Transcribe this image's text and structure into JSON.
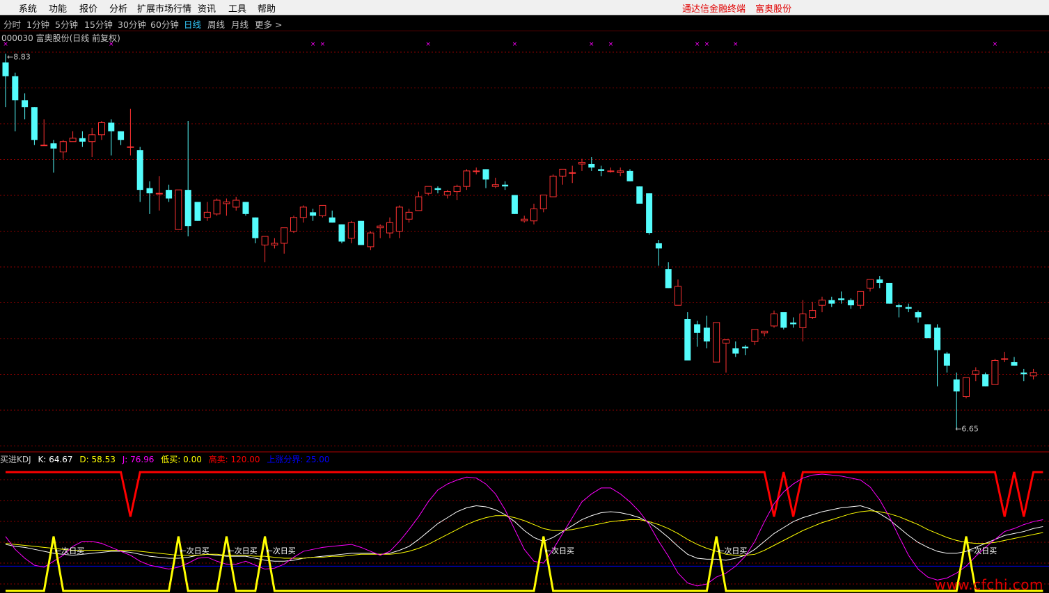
{
  "menu": {
    "items": [
      "系统",
      "功能",
      "报价",
      "分析",
      "扩展市场行情",
      "资讯",
      "工具",
      "帮助"
    ],
    "right_items": [
      "通达信金融终端",
      "富奥股份"
    ]
  },
  "periods": {
    "items": [
      "分时",
      "1分钟",
      "5分钟",
      "15分钟",
      "30分钟",
      "60分钟",
      "日线",
      "周线",
      "月线",
      "更多 >"
    ],
    "active_index": 6
  },
  "main": {
    "title": "000030 富奥股份(日线 前复权)",
    "high_label": "8.83",
    "low_label": "6.65"
  },
  "kdj": {
    "name": "买进KDJ",
    "k_label": "K: 64.67",
    "d_label": "D: 58.53",
    "j_label": "J: 76.96",
    "low_label": "低买: 0.00",
    "high_label": "高卖: 120.00",
    "line_label": "上涨分界: 25.00",
    "buy_text": "次日买"
  },
  "watermark": "www.cfchi.com",
  "colors": {
    "up": "#ff3232",
    "down": "#54fcfc",
    "k": "#ffffff",
    "d": "#ffff00",
    "j": "#ff00ff",
    "signal": "#ffff00",
    "sell": "#ff0000",
    "divider": "#0000ff"
  },
  "chart_data": [
    {
      "type": "candlestick",
      "title": "000030 富奥股份(日线 前复权)",
      "price_range": [
        6.6,
        8.9
      ],
      "annotations": [
        "8.83",
        "6.65"
      ],
      "candles": [
        [
          8.78,
          8.83,
          8.52,
          8.7
        ],
        [
          8.7,
          8.72,
          8.38,
          8.56
        ],
        [
          8.56,
          8.6,
          8.45,
          8.52
        ],
        [
          8.52,
          8.52,
          8.3,
          8.33
        ],
        [
          8.3,
          8.45,
          8.3,
          8.3
        ],
        [
          8.31,
          8.33,
          8.14,
          8.28
        ],
        [
          8.26,
          8.33,
          8.22,
          8.32
        ],
        [
          8.32,
          8.38,
          8.33,
          8.34
        ],
        [
          8.34,
          8.38,
          8.29,
          8.32
        ],
        [
          8.32,
          8.4,
          8.23,
          8.36
        ],
        [
          8.36,
          8.44,
          8.33,
          8.43
        ],
        [
          8.43,
          8.45,
          8.24,
          8.38
        ],
        [
          8.38,
          8.38,
          8.3,
          8.33
        ],
        [
          8.29,
          8.51,
          8.24,
          8.29
        ],
        [
          8.27,
          8.29,
          7.97,
          8.04
        ],
        [
          8.05,
          8.09,
          7.9,
          8.02
        ],
        [
          8.02,
          8.12,
          7.92,
          8.02
        ],
        [
          8.04,
          8.07,
          7.97,
          7.99
        ],
        [
          7.81,
          8.02,
          7.81,
          8.04
        ],
        [
          8.04,
          8.44,
          7.77,
          7.83
        ],
        [
          7.97,
          7.97,
          7.86,
          7.86
        ],
        [
          7.88,
          7.97,
          7.86,
          7.91
        ],
        [
          7.9,
          7.99,
          7.89,
          7.98
        ],
        [
          7.96,
          7.99,
          7.89,
          7.97
        ],
        [
          7.94,
          8.0,
          7.92,
          7.98
        ],
        [
          7.97,
          7.97,
          7.89,
          7.9
        ],
        [
          7.88,
          7.88,
          7.73,
          7.76
        ],
        [
          7.72,
          7.76,
          7.62,
          7.77
        ],
        [
          7.72,
          7.76,
          7.7,
          7.73
        ],
        [
          7.73,
          7.82,
          7.67,
          7.82
        ],
        [
          7.8,
          7.89,
          7.79,
          7.88
        ],
        [
          7.88,
          7.95,
          7.85,
          7.94
        ],
        [
          7.91,
          7.93,
          7.86,
          7.89
        ],
        [
          7.89,
          7.95,
          7.88,
          7.95
        ],
        [
          7.88,
          7.92,
          7.85,
          7.85
        ],
        [
          7.84,
          7.84,
          7.73,
          7.74
        ],
        [
          7.76,
          7.86,
          7.73,
          7.85
        ],
        [
          7.86,
          7.86,
          7.72,
          7.72
        ],
        [
          7.71,
          7.8,
          7.69,
          7.79
        ],
        [
          7.82,
          7.84,
          7.76,
          7.83
        ],
        [
          7.79,
          7.88,
          7.76,
          7.85
        ],
        [
          7.8,
          7.95,
          7.76,
          7.94
        ],
        [
          7.87,
          7.93,
          7.85,
          7.91
        ],
        [
          7.92,
          8.03,
          7.92,
          8.0
        ],
        [
          8.02,
          8.06,
          8.01,
          8.06
        ],
        [
          8.05,
          8.06,
          8.02,
          8.04
        ],
        [
          8.01,
          8.04,
          7.99,
          8.03
        ],
        [
          8.03,
          8.07,
          7.98,
          8.06
        ],
        [
          8.06,
          8.16,
          8.04,
          8.15
        ],
        [
          8.15,
          8.17,
          8.13,
          8.15
        ],
        [
          8.16,
          8.16,
          8.05,
          8.1
        ],
        [
          8.06,
          8.11,
          8.05,
          8.07
        ],
        [
          8.07,
          8.09,
          8.04,
          8.06
        ],
        [
          8.01,
          8.01,
          7.9,
          7.9
        ],
        [
          7.86,
          7.89,
          7.85,
          7.87
        ],
        [
          7.86,
          7.96,
          7.84,
          7.93
        ],
        [
          7.93,
          8.01,
          7.91,
          8.01
        ],
        [
          8.0,
          8.13,
          8.0,
          8.12
        ],
        [
          8.12,
          8.16,
          8.07,
          8.16
        ],
        [
          8.14,
          8.18,
          8.08,
          8.14
        ],
        [
          8.19,
          8.22,
          8.15,
          8.2
        ],
        [
          8.19,
          8.23,
          8.15,
          8.17
        ],
        [
          8.16,
          8.18,
          8.12,
          8.15
        ],
        [
          8.15,
          8.17,
          8.14,
          8.15
        ],
        [
          8.14,
          8.17,
          8.12,
          8.15
        ],
        [
          8.15,
          8.16,
          8.09,
          8.09
        ],
        [
          8.06,
          8.06,
          7.98,
          7.96
        ],
        [
          8.02,
          8.02,
          7.78,
          7.79
        ],
        [
          7.73,
          7.75,
          7.6,
          7.7
        ],
        [
          7.58,
          7.62,
          7.47,
          7.47
        ],
        [
          7.37,
          7.52,
          7.38,
          7.48
        ],
        [
          7.29,
          7.33,
          7.09,
          7.05
        ],
        [
          7.26,
          7.28,
          7.13,
          7.21
        ],
        [
          7.24,
          7.31,
          7.12,
          7.16
        ],
        [
          7.04,
          7.24,
          7.04,
          7.27
        ],
        [
          7.15,
          7.16,
          6.98,
          7.17
        ],
        [
          7.12,
          7.16,
          7.07,
          7.09
        ],
        [
          7.13,
          7.14,
          7.08,
          7.12
        ],
        [
          7.16,
          7.23,
          7.14,
          7.23
        ],
        [
          7.21,
          7.22,
          7.19,
          7.22
        ],
        [
          7.25,
          7.34,
          7.24,
          7.32
        ],
        [
          7.33,
          7.3,
          7.23,
          7.24
        ],
        [
          7.27,
          7.3,
          7.24,
          7.26
        ],
        [
          7.24,
          7.4,
          7.16,
          7.32
        ],
        [
          7.3,
          7.39,
          7.29,
          7.34
        ],
        [
          7.37,
          7.42,
          7.33,
          7.4
        ],
        [
          7.4,
          7.42,
          7.36,
          7.38
        ],
        [
          7.41,
          7.45,
          7.38,
          7.4
        ],
        [
          7.4,
          7.41,
          7.35,
          7.37
        ],
        [
          7.37,
          7.42,
          7.35,
          7.45
        ],
        [
          7.47,
          7.52,
          7.45,
          7.52
        ],
        [
          7.52,
          7.54,
          7.47,
          7.5
        ],
        [
          7.5,
          7.5,
          7.38,
          7.38
        ],
        [
          7.37,
          7.38,
          7.3,
          7.36
        ],
        [
          7.36,
          7.38,
          7.33,
          7.35
        ],
        [
          7.33,
          7.34,
          7.27,
          7.3
        ],
        [
          7.26,
          7.26,
          7.18,
          7.18
        ],
        [
          7.24,
          7.26,
          6.9,
          7.11
        ],
        [
          7.09,
          7.1,
          6.98,
          7.02
        ],
        [
          6.94,
          6.98,
          6.65,
          6.87
        ],
        [
          6.84,
          6.95,
          6.83,
          6.95
        ],
        [
          6.97,
          7.01,
          6.93,
          6.99
        ],
        [
          6.97,
          6.98,
          6.9,
          6.9
        ],
        [
          6.91,
          7.06,
          6.91,
          7.05
        ],
        [
          7.06,
          7.1,
          7.04,
          7.06
        ],
        [
          7.04,
          7.07,
          7.02,
          7.02
        ],
        [
          6.98,
          7.0,
          6.93,
          6.97
        ],
        [
          6.96,
          7.0,
          6.94,
          6.98
        ]
      ],
      "signal_marks_x": [
        0,
        11,
        32,
        33,
        44,
        53,
        61,
        63,
        72,
        73,
        76,
        103
      ]
    },
    {
      "type": "line",
      "title": "买进KDJ",
      "ylim": [
        0,
        125
      ],
      "reference_lines": {
        "high": 120,
        "low": 0,
        "boundary": 25
      },
      "series": [
        {
          "name": "K",
          "values": [
            47,
            45,
            44,
            42,
            40,
            38,
            37,
            36,
            37,
            38,
            39,
            40,
            40,
            39,
            37,
            35,
            34,
            33,
            33,
            34,
            36,
            37,
            36,
            35,
            35,
            35,
            33,
            31,
            30,
            30,
            31,
            33,
            34,
            35,
            36,
            37,
            38,
            38,
            38,
            37,
            38,
            41,
            45,
            52,
            60,
            68,
            74,
            80,
            84,
            86,
            85,
            82,
            77,
            70,
            61,
            54,
            50,
            54,
            60,
            66,
            72,
            76,
            79,
            80,
            79,
            77,
            74,
            69,
            62,
            54,
            45,
            37,
            33,
            32,
            32,
            31,
            33,
            36,
            42,
            50,
            58,
            64,
            70,
            74,
            77,
            80,
            82,
            84,
            85,
            86,
            83,
            78,
            72,
            64,
            56,
            49,
            44,
            40,
            38,
            38,
            40,
            44,
            48,
            52,
            56,
            58,
            60,
            63,
            65
          ]
        },
        {
          "name": "D",
          "values": [
            48,
            47,
            46,
            45,
            44,
            43,
            42,
            41,
            41,
            41,
            41,
            41,
            41,
            41,
            40,
            39,
            38,
            37,
            36,
            36,
            36,
            37,
            37,
            36,
            36,
            36,
            35,
            35,
            34,
            33,
            33,
            33,
            34,
            34,
            35,
            35,
            36,
            37,
            37,
            37,
            37,
            38,
            40,
            43,
            47,
            52,
            57,
            62,
            67,
            71,
            74,
            76,
            76,
            74,
            71,
            67,
            63,
            61,
            61,
            62,
            64,
            66,
            68,
            70,
            71,
            72,
            72,
            70,
            67,
            63,
            58,
            52,
            47,
            43,
            40,
            37,
            36,
            36,
            37,
            41,
            46,
            51,
            56,
            61,
            65,
            69,
            72,
            75,
            78,
            80,
            81,
            80,
            78,
            75,
            71,
            67,
            62,
            58,
            54,
            51,
            49,
            48,
            48,
            49,
            51,
            53,
            55,
            57,
            59
          ]
        },
        {
          "name": "J",
          "values": [
            55,
            42,
            33,
            26,
            24,
            30,
            36,
            45,
            50,
            50,
            48,
            44,
            40,
            36,
            30,
            26,
            24,
            22,
            24,
            28,
            33,
            34,
            30,
            27,
            27,
            30,
            26,
            22,
            23,
            27,
            34,
            40,
            42,
            44,
            45,
            46,
            47,
            44,
            40,
            36,
            40,
            50,
            62,
            75,
            90,
            102,
            108,
            112,
            115,
            114,
            108,
            98,
            82,
            62,
            42,
            30,
            28,
            42,
            58,
            74,
            90,
            98,
            104,
            104,
            98,
            90,
            80,
            67,
            50,
            35,
            18,
            8,
            5,
            7,
            14,
            18,
            25,
            35,
            50,
            70,
            88,
            100,
            108,
            114,
            117,
            118,
            117,
            116,
            114,
            112,
            105,
            92,
            75,
            55,
            36,
            22,
            14,
            11,
            13,
            18,
            25,
            35,
            44,
            52,
            60,
            63,
            67,
            70,
            72
          ]
        }
      ]
    }
  ]
}
